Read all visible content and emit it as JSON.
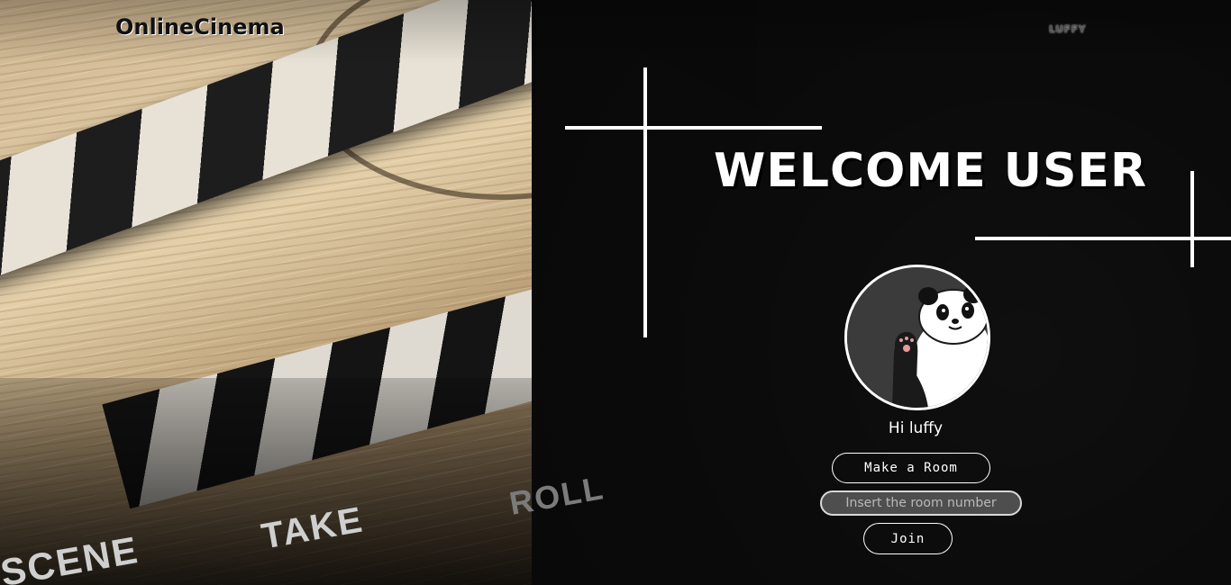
{
  "header": {
    "brand": "OnlineCinema",
    "user_nav": "LUFFY"
  },
  "main": {
    "title": "WELCOME USER",
    "greeting": "Hi luffy",
    "make_room_label": "Make a Room",
    "room_input_placeholder": "Insert the room number",
    "room_input_value": "",
    "join_label": "Join"
  },
  "background": {
    "slate_words": [
      "SCENE",
      "TAKE",
      "ROLL"
    ]
  },
  "icons": {
    "avatar": "panda-avatar-icon"
  },
  "colors": {
    "text": "#ffffff",
    "panel": "#0a0a0a",
    "input_bg": "#4e4e4e"
  }
}
